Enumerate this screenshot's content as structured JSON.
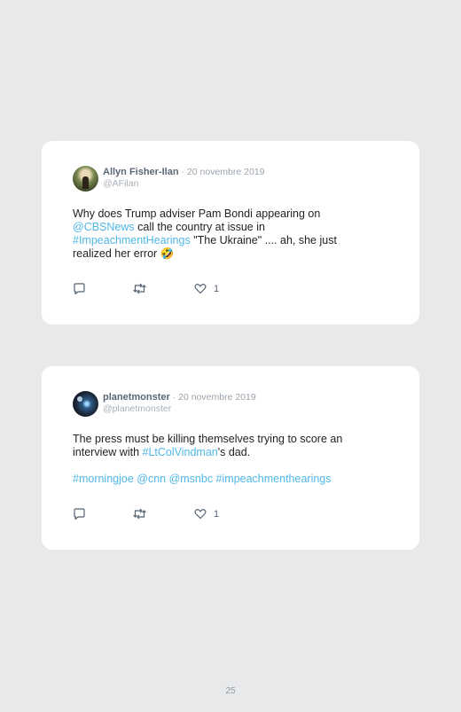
{
  "tweets": [
    {
      "display_name": "Allyn Fisher-Ilan",
      "separator": " · ",
      "date": "20 novembre 2019",
      "handle": "@AFilan",
      "text": {
        "p1": "Why does Trump adviser Pam Bondi appearing on",
        "mention": "@CBSNews",
        "p2": " call the country at issue in",
        "hashtag": "#ImpeachmentHearings",
        "p3": " \"The Ukraine\" .... ah, she just realized her error 🤣"
      },
      "likes": "1"
    },
    {
      "display_name": "planetmonster",
      "separator": " · ",
      "date": "20 novembre 2019",
      "handle": "@planetmonster",
      "text": {
        "p1": "The press must be killing themselves trying to score an interview with ",
        "hashtag": "#LtColVindman",
        "p2": "'s dad.",
        "hashtags_line": "#morningjoe @cnn @msnbc #impeachmenthearings"
      },
      "likes": "1"
    }
  ],
  "page_number": "25",
  "colors": {
    "link": "#4fb7e8",
    "background": "#e8e9eb",
    "card": "#ffffff"
  },
  "icons": [
    "reply-icon",
    "retweet-icon",
    "heart-icon"
  ]
}
